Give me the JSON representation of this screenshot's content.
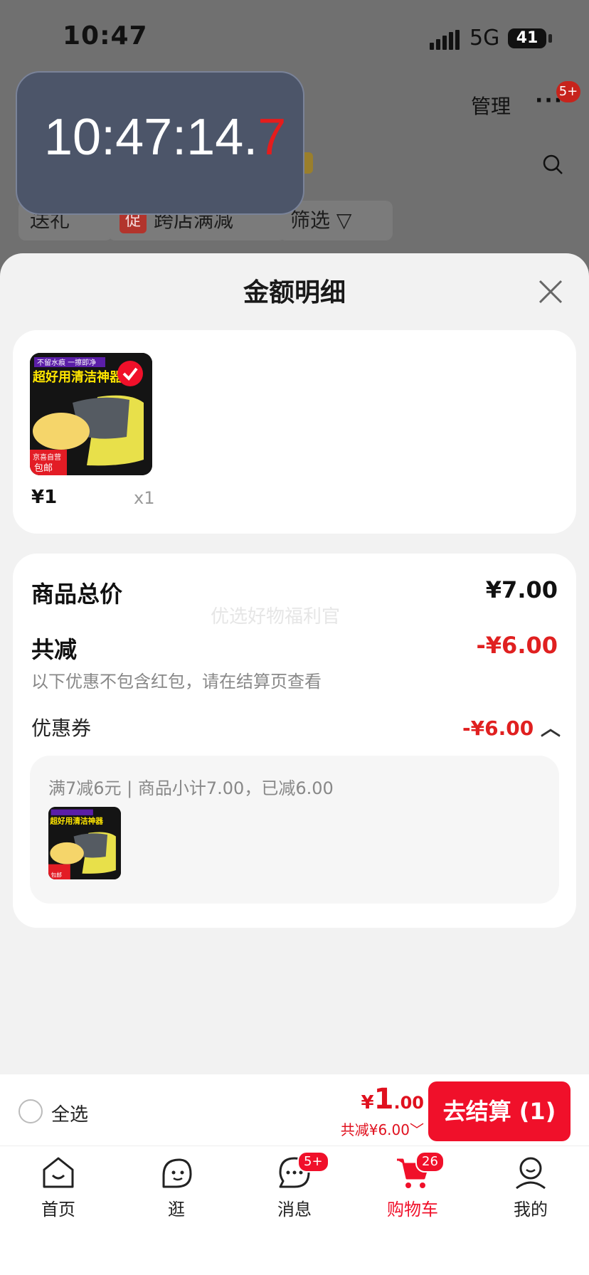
{
  "status_bar": {
    "time": "10:47",
    "network": "5G",
    "battery": "41"
  },
  "timer_overlay": {
    "main": "10:47:14.",
    "fraction": "7"
  },
  "background": {
    "manage_label": "管理",
    "more_label": "···",
    "more_badge": "5+",
    "chips": [
      {
        "label": "送礼"
      },
      {
        "tag": "促",
        "label": "跨店满减"
      },
      {
        "label": "筛选"
      }
    ]
  },
  "sheet": {
    "title": "金额明细",
    "items": [
      {
        "price": "¥1",
        "qty": "x1",
        "thumb_text_top": "不留水痕 一擦即净",
        "thumb_text_main": "超好用清洁神器",
        "thumb_tag_1": "京喜自营",
        "thumb_tag_2": "包邮"
      }
    ],
    "summary": {
      "total_label": "商品总价",
      "total_value": "¥7.00",
      "watermark": "优选好物福利官",
      "discount_label": "共减",
      "discount_value": "-¥6.00",
      "note": "以下优惠不包含红包，请在结算页查看",
      "coupon_label": "优惠券",
      "coupon_value": "-¥6.00",
      "coupon_desc": "满7减6元 | 商品小计7.00，已减6.00"
    }
  },
  "footer": {
    "select_all": "全选",
    "total_symbol": "¥",
    "total_int": "1",
    "total_dec": ".00",
    "discount": "共减¥6.00",
    "checkout": "去结算 (1)"
  },
  "nav": [
    {
      "label": "首页",
      "icon": "home-icon"
    },
    {
      "label": "逛",
      "icon": "browse-icon"
    },
    {
      "label": "消息",
      "icon": "message-icon",
      "badge": "5+"
    },
    {
      "label": "购物车",
      "icon": "cart-icon",
      "badge": "26",
      "active": true
    },
    {
      "label": "我的",
      "icon": "profile-icon"
    }
  ],
  "colors": {
    "accent": "#f0102a",
    "discount": "#e02020",
    "overlay": "#4c5569"
  }
}
